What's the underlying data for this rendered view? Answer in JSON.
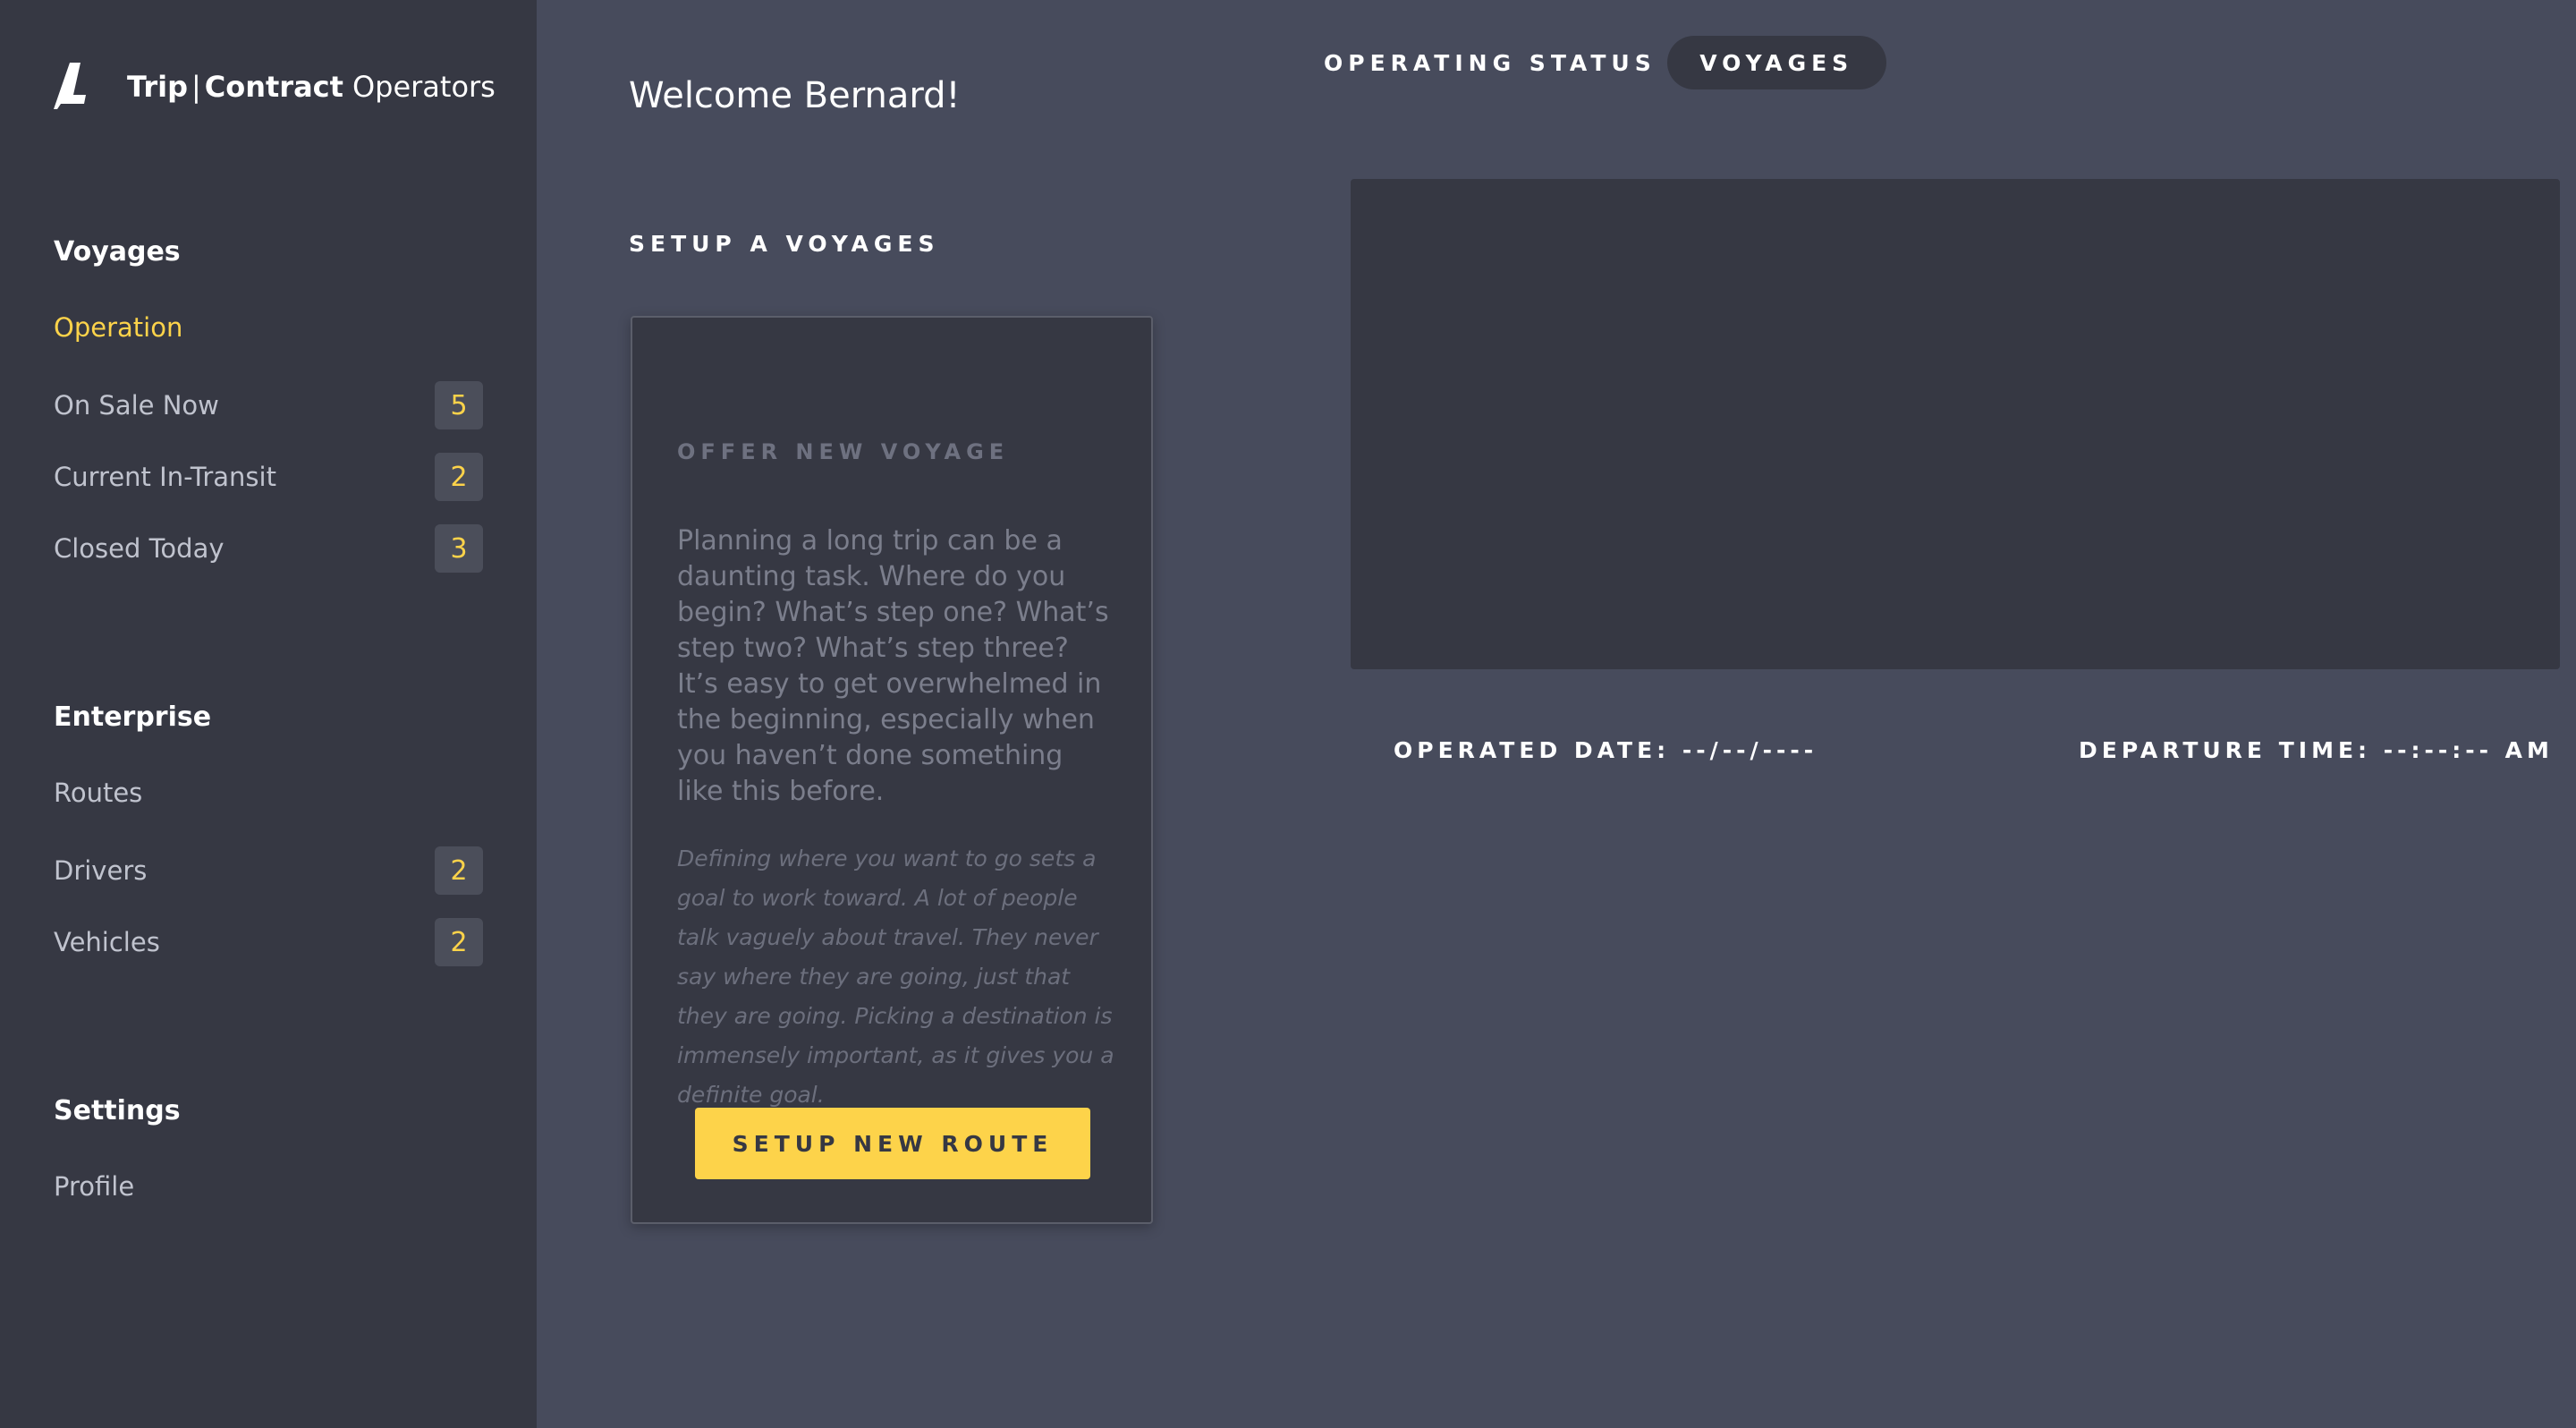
{
  "brand": {
    "trip": "Trip",
    "separator": "|",
    "contract": "Contract",
    "operators": "Operators",
    "logo_icon": "logo-icon"
  },
  "sidebar": {
    "sections": [
      {
        "title": "Voyages",
        "items": [
          {
            "label": "Operation",
            "active": true,
            "badge": null
          },
          {
            "label": "On Sale Now",
            "badge": "5"
          },
          {
            "label": "Current In-Transit",
            "badge": "2"
          },
          {
            "label": "Closed Today",
            "badge": "3"
          }
        ]
      },
      {
        "title": "Enterprise",
        "items": [
          {
            "label": "Routes",
            "badge": null
          },
          {
            "label": "Drivers",
            "badge": "2"
          },
          {
            "label": "Vehicles",
            "badge": "2"
          }
        ]
      },
      {
        "title": "Settings",
        "items": [
          {
            "label": "Profile",
            "badge": null
          }
        ]
      }
    ]
  },
  "header": {
    "welcome": "Welcome Bernard!",
    "operating_status_label": "OPERATING STATUS",
    "status_pill": "VOYAGES"
  },
  "main": {
    "setup_title": "SETUP A VOYAGES",
    "card": {
      "kicker": "OFFER NEW VOYAGE",
      "body": "Planning a long trip can be a daunting task. Where do you begin? What’s step one? What’s step two? What’s step three? It’s easy to get overwhelmed in the beginning, especially when you haven’t done something like this before.",
      "italic": "Defining where you want to go sets a goal to work toward. A lot of people talk vaguely about travel. They never say where they are going, just that they are going. Picking a destination is immensely important, as it gives you a definite goal.",
      "button": "SETUP NEW ROUTE"
    },
    "operated_date": "OPERATED DATE: --/--/----",
    "departure_time": "DEPARTURE TIME: --:--:-- AM"
  },
  "colors": {
    "background": "#474b5c",
    "sidebar": "#363843",
    "accent": "#fdd34a"
  }
}
